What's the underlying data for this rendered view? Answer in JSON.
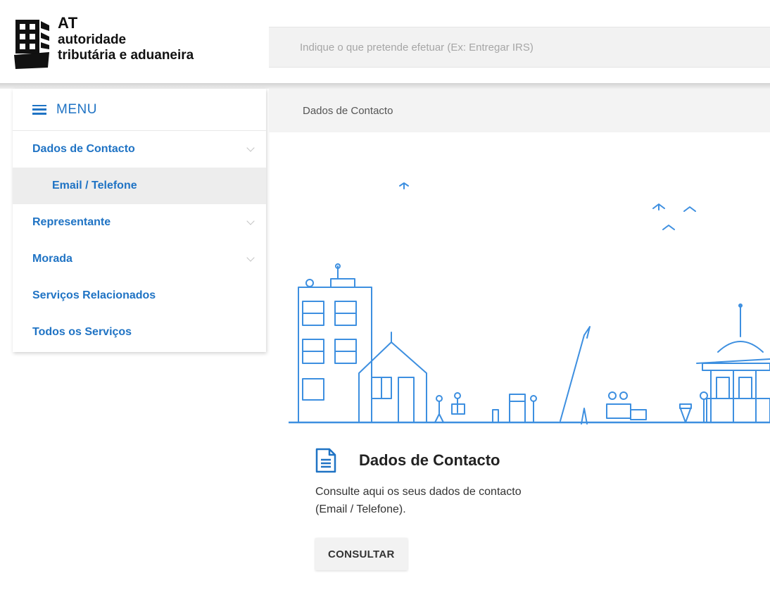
{
  "brand": {
    "acronym": "AT",
    "line1": "autoridade",
    "line2": "tributária e aduaneira"
  },
  "search": {
    "placeholder": "Indique o que pretende efetuar (Ex: Entregar IRS)",
    "value": ""
  },
  "sidebar": {
    "menu_label": "MENU",
    "items": [
      {
        "label": "Dados de Contacto",
        "expandable": true
      },
      {
        "label": "Email / Telefone",
        "sub": true,
        "active": true
      },
      {
        "label": "Representante",
        "expandable": true
      },
      {
        "label": "Morada",
        "expandable": true
      },
      {
        "label": "Serviços Relacionados"
      },
      {
        "label": "Todos os Serviços"
      }
    ]
  },
  "breadcrumb": "Dados de Contacto",
  "card": {
    "icon": "document-icon",
    "title": "Dados de Contacto",
    "description": "Consulte aqui os seus dados de contacto (Email / Telefone).",
    "button_label": "CONSULTAR"
  },
  "colors": {
    "accent": "#1f73c4",
    "illustration_line": "#3d8fe0",
    "submenu_bg": "#ededed",
    "bar_bg": "#f3f3f3"
  }
}
